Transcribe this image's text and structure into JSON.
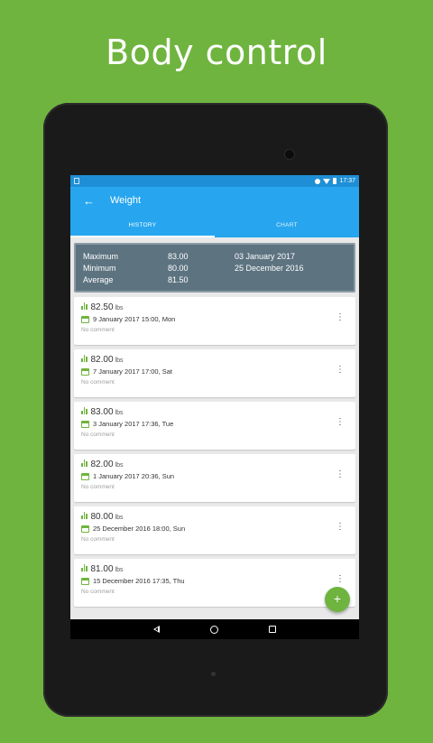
{
  "headline": "Body control",
  "statusbar": {
    "time": "17:37"
  },
  "appbar": {
    "title": "Weight"
  },
  "tabs": [
    {
      "label": "HISTORY",
      "active": true
    },
    {
      "label": "CHART",
      "active": false
    }
  ],
  "summary": {
    "max_label": "Maximum",
    "max_value": "83.00",
    "max_date": "03 January 2017",
    "min_label": "Minimum",
    "min_value": "80.00",
    "min_date": "25 December 2016",
    "avg_label": "Average",
    "avg_value": "81.50"
  },
  "entries": [
    {
      "weight": "82.50",
      "unit": "lbs",
      "date": "9 January 2017 15:00, Mon",
      "comment": "No comment"
    },
    {
      "weight": "82.00",
      "unit": "lbs",
      "date": "7 January 2017 17:00, Sat",
      "comment": "No comment"
    },
    {
      "weight": "83.00",
      "unit": "lbs",
      "date": "3 January 2017 17:36, Tue",
      "comment": "No comment"
    },
    {
      "weight": "82.00",
      "unit": "lbs",
      "date": "1 January 2017 20:36, Sun",
      "comment": "No comment"
    },
    {
      "weight": "80.00",
      "unit": "lbs",
      "date": "25 December 2016 18:00, Sun",
      "comment": "No comment"
    },
    {
      "weight": "81.00",
      "unit": "lbs",
      "date": "15 December 2016 17:35, Thu",
      "comment": "No comment"
    }
  ],
  "colors": {
    "background": "#6fb43f",
    "appbar": "#27a6ef",
    "statusbar": "#1e8fd6",
    "accent": "#6fb43f",
    "summary": "#5d7380"
  }
}
